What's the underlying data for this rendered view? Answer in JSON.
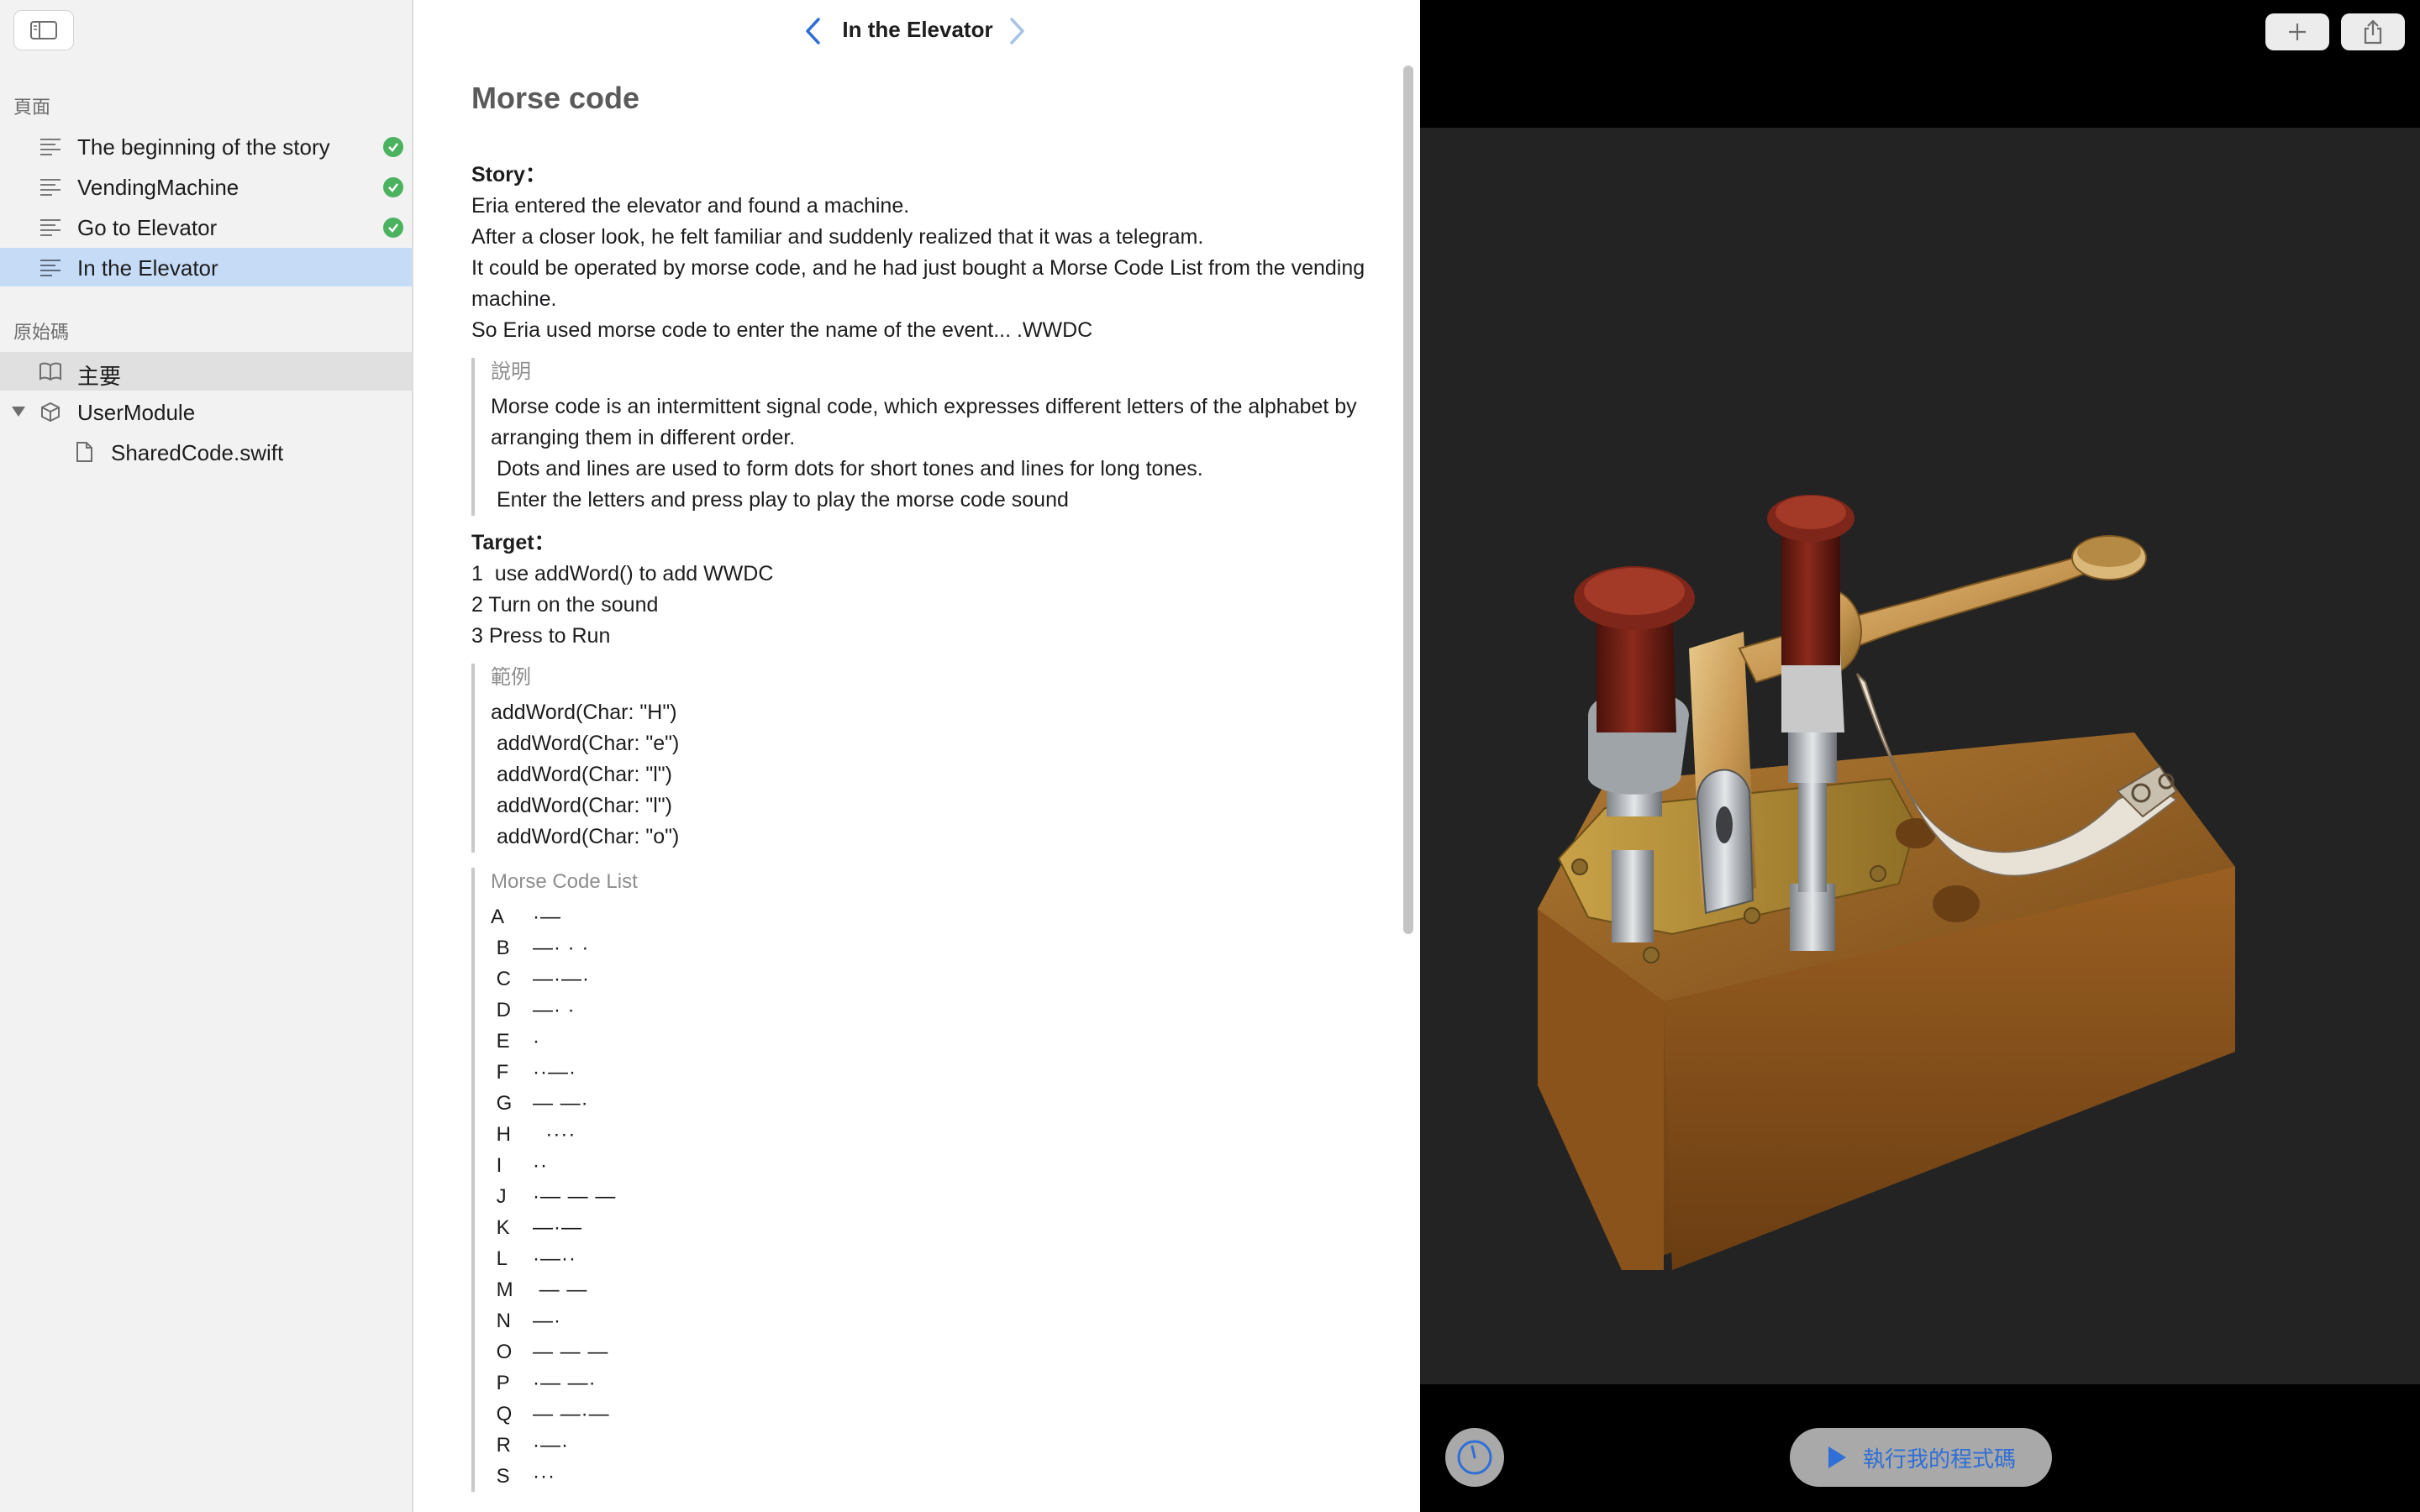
{
  "sidebar": {
    "pages_header": "頁面",
    "pages": [
      {
        "label": "The beginning of the story",
        "completed": true
      },
      {
        "label": "VendingMachine",
        "completed": true
      },
      {
        "label": "Go to Elevator",
        "completed": true
      },
      {
        "label": "In the Elevator",
        "completed": false,
        "selected": true
      }
    ],
    "source_header": "原始碼",
    "source_items": [
      {
        "label": "主要",
        "icon": "book-icon"
      },
      {
        "label": "UserModule",
        "icon": "module-icon"
      },
      {
        "label": "SharedCode.swift",
        "icon": "file-icon"
      }
    ]
  },
  "nav": {
    "title": "In the Elevator"
  },
  "doc": {
    "heading": "Morse code",
    "story_label": "Story：",
    "story_lines": [
      "Eria entered the elevator and found a machine.",
      "After a closer look, he felt familiar and suddenly realized that it was a telegram.",
      "It could be operated by morse code, and he had just bought a Morse Code List from the vending machine.",
      "So Eria used morse code to enter the name of the event... .WWDC"
    ],
    "note": {
      "title": "說明",
      "lines": [
        "Morse code is an intermittent signal code, which expresses different letters of the alphabet by arranging them in different order.",
        " Dots and lines are used to form dots for short tones and lines for long tones.",
        " Enter the letters and press play to play the morse code sound"
      ]
    },
    "target_label": "Target：",
    "target_lines": [
      "1  use addWord() to add WWDC",
      "2 Turn on the sound",
      "3 Press to Run"
    ],
    "example": {
      "title": "範例",
      "lines": [
        "addWord(Char: \"H\")",
        " addWord(Char: \"e\")",
        " addWord(Char: \"l\")",
        " addWord(Char: \"l\")",
        " addWord(Char: \"o\")"
      ]
    },
    "morse_list": {
      "title": "Morse Code List",
      "rows": [
        {
          "letter": "A",
          "code": "·—"
        },
        {
          "letter": " B",
          "code": "—· · ·"
        },
        {
          "letter": " C",
          "code": "—·—·"
        },
        {
          "letter": " D",
          "code": "—· ·"
        },
        {
          "letter": " E",
          "code": "·"
        },
        {
          "letter": " F",
          "code": "··—·"
        },
        {
          "letter": " G",
          "code": "— —·"
        },
        {
          "letter": " H",
          "code": "  ····"
        },
        {
          "letter": " I",
          "code": "··"
        },
        {
          "letter": " J",
          "code": "·— — —"
        },
        {
          "letter": " K",
          "code": "—·—"
        },
        {
          "letter": " L",
          "code": "·—··"
        },
        {
          "letter": " M",
          "code": " — —"
        },
        {
          "letter": " N",
          "code": "—·"
        },
        {
          "letter": " O",
          "code": "— — —"
        },
        {
          "letter": " P",
          "code": "·— —·"
        },
        {
          "letter": " Q",
          "code": "— —·—"
        },
        {
          "letter": " R",
          "code": "·—·"
        },
        {
          "letter": " S",
          "code": "···"
        }
      ]
    }
  },
  "live": {
    "run_label": "執行我的程式碼"
  },
  "colors": {
    "selected_row": "#c6dcf6",
    "check_green": "#4bb35f",
    "accent_blue": "#2f6fd6"
  }
}
